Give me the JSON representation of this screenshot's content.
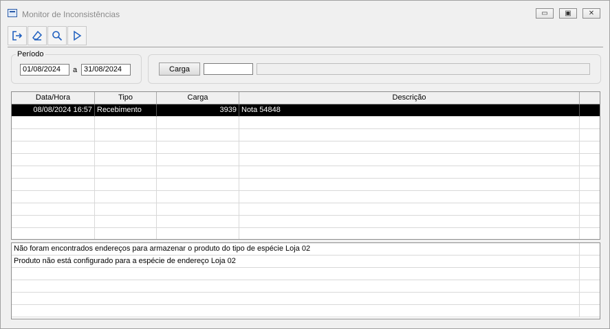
{
  "window": {
    "title": "Monitor de Inconsistências"
  },
  "titlebar": {
    "minimize_glyph": "▭",
    "restore_glyph": "▣",
    "close_glyph": "✕"
  },
  "toolbar": {
    "icons": [
      "exit-icon",
      "eraser-icon",
      "search-icon",
      "play-icon"
    ]
  },
  "periodo": {
    "label": "Período",
    "from": "01/08/2024",
    "separator": "a",
    "to": "31/08/2024"
  },
  "carga": {
    "button_label": "Carga",
    "code_value": "",
    "description_value": ""
  },
  "main_grid": {
    "columns": [
      "Data/Hora",
      "Tipo",
      "Carga",
      "Descrição"
    ],
    "rows": [
      {
        "datahora": "08/08/2024 16:57",
        "tipo": "Recebimento",
        "carga": "3939",
        "descricao": "Nota 54848",
        "selected": true
      }
    ]
  },
  "detail_grid": {
    "rows": [
      "Não foram encontrados endereços para armazenar o produto do tipo de espécie Loja 02",
      "Produto não está configurado para a espécie de endereço Loja 02"
    ]
  },
  "colors": {
    "selection_bg": "#000000",
    "selection_fg": "#ffffff",
    "accent": "#2a5ba8"
  }
}
